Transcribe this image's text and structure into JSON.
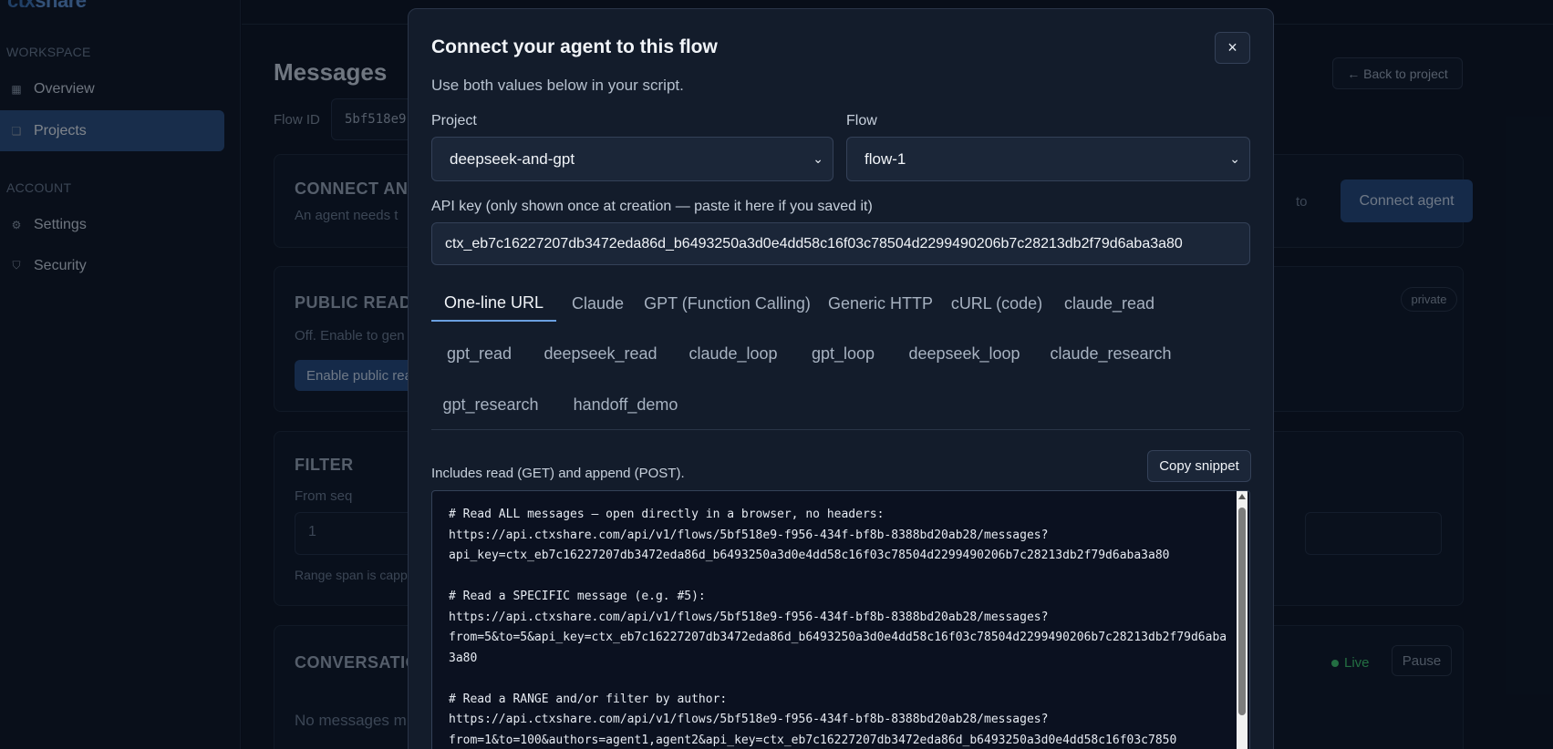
{
  "sidebar": {
    "brand": "ctxshare",
    "brand_prefix": "ctx",
    "brand_suffix": "share",
    "sections": [
      {
        "title": "WORKSPACE",
        "items": [
          {
            "label": "Overview",
            "icon": "grid-icon"
          },
          {
            "label": "Projects",
            "icon": "folder-icon",
            "active": true
          }
        ]
      },
      {
        "title": "ACCOUNT",
        "items": [
          {
            "label": "Settings",
            "icon": "gear-icon"
          },
          {
            "label": "Security",
            "icon": "shield-icon"
          }
        ]
      }
    ]
  },
  "page": {
    "title": "Messages",
    "back_label": "← Back to project",
    "flow_id_label": "Flow ID",
    "flow_id_value": "5bf518e9",
    "connect_card": {
      "heading": "CONNECT AN",
      "text": "An agent needs t",
      "partial_button": "to",
      "connect_button": "Connect agent"
    },
    "public_card": {
      "heading": "PUBLIC READ-",
      "text": "Off. Enable to gen",
      "button": "Enable public rea",
      "badge": "private"
    },
    "filter_card": {
      "heading": "FILTER",
      "from_label": "From seq",
      "from_value": "1",
      "note": "Range span is capp"
    },
    "conversation_card": {
      "heading": "CONVERSATIO",
      "empty": "No messages m",
      "live_label": "Live",
      "pause_label": "Pause"
    }
  },
  "modal": {
    "title": "Connect your agent to this flow",
    "subtitle": "Use both values below in your script.",
    "close": "×",
    "project_label": "Project",
    "project_value": "deepseek-and-gpt",
    "flow_label": "Flow",
    "flow_value": "flow-1",
    "api_key_label": "API key (only shown once at creation — paste it here if you saved it)",
    "api_key_value": "ctx_eb7c16227207db3472eda86d_b6493250a3d0e4dd58c16f03c78504d2299490206b7c28213db2f79d6aba3a80",
    "tabs": [
      "One-line URL",
      "Claude",
      "GPT (Function Calling)",
      "Generic HTTP",
      "cURL (code)",
      "claude_read",
      "gpt_read",
      "deepseek_read",
      "claude_loop",
      "gpt_loop",
      "deepseek_loop",
      "claude_research",
      "gpt_research",
      "handoff_demo"
    ],
    "active_tab": "One-line URL",
    "note": "Includes read (GET) and append (POST).",
    "copy_label": "Copy snippet",
    "snippet": "# Read ALL messages — open directly in a browser, no headers:\nhttps://api.ctxshare.com/api/v1/flows/5bf518e9-f956-434f-bf8b-8388bd20ab28/messages?\napi_key=ctx_eb7c16227207db3472eda86d_b6493250a3d0e4dd58c16f03c78504d2299490206b7c28213db2f79d6aba3a80\n\n# Read a SPECIFIC message (e.g. #5):\nhttps://api.ctxshare.com/api/v1/flows/5bf518e9-f956-434f-bf8b-8388bd20ab28/messages?\nfrom=5&to=5&api_key=ctx_eb7c16227207db3472eda86d_b6493250a3d0e4dd58c16f03c78504d2299490206b7c28213db2f79d6aba3a80\n\n# Read a RANGE and/or filter by author:\nhttps://api.ctxshare.com/api/v1/flows/5bf518e9-f956-434f-bf8b-8388bd20ab28/messages?\nfrom=1&to=100&authors=agent1,agent2&api_key=ctx_eb7c16227207db3472eda86d_b6493250a3d0e4dd58c16f03c7850"
  },
  "colors": {
    "accent": "#6aa0e0",
    "active_nav": "#2a4e7e",
    "live": "#3ec46d"
  }
}
